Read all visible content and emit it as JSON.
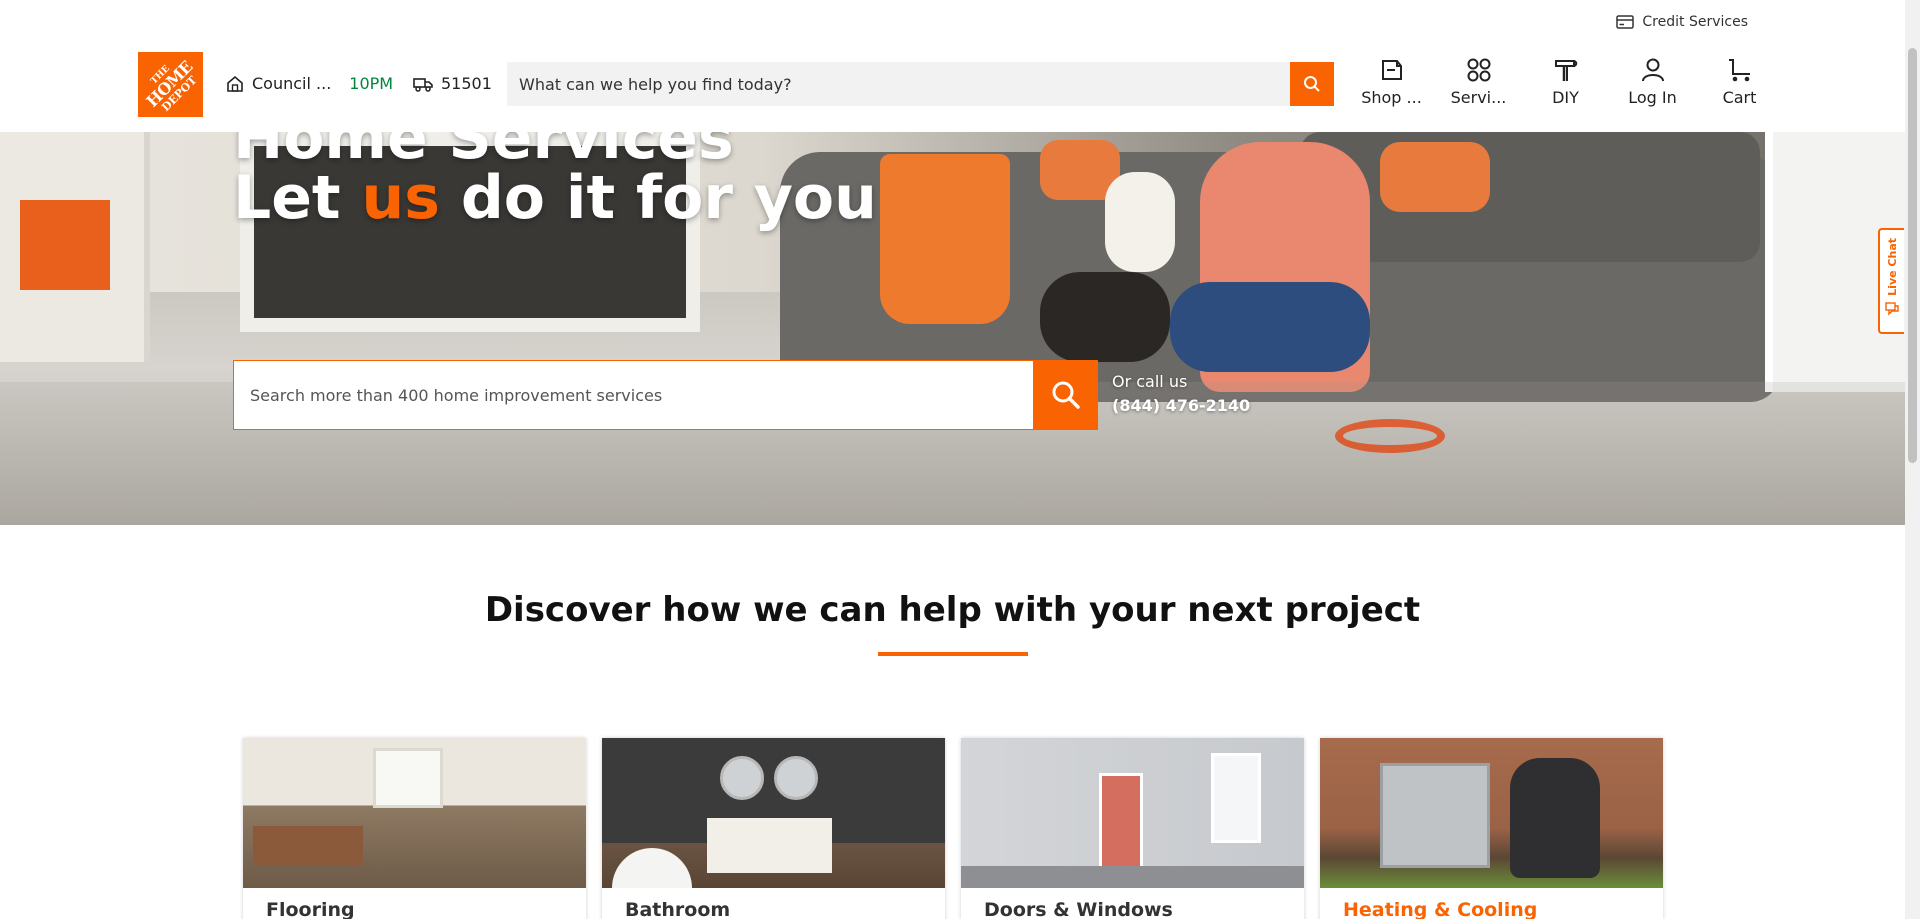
{
  "header": {
    "credit_services": "Credit Services",
    "logo_text": [
      "THE",
      "HOME",
      "DEPOT"
    ],
    "store_name": "Council ...",
    "store_hours": "10PM",
    "delivery_zip": "51501",
    "search_placeholder": "What can we help you find today?",
    "nav": [
      {
        "label": "Shop ...",
        "icon": "shop-icon"
      },
      {
        "label": "Servi...",
        "icon": "services-icon"
      },
      {
        "label": "DIY",
        "icon": "hammer-icon"
      },
      {
        "label": "Log In",
        "icon": "user-icon"
      },
      {
        "label": "Cart",
        "icon": "cart-icon"
      }
    ]
  },
  "hero": {
    "title_line1": "Home Services",
    "title_line2_pre": "Let ",
    "title_line2_accent": "us",
    "title_line2_post": " do it for you",
    "search_placeholder": "Search more than 400 home improvement services",
    "call_label": "Or call us",
    "phone": "(844) 476-2140"
  },
  "live_chat": "Live Chat",
  "discover": {
    "title": "Discover how we can help with your next project"
  },
  "cards": [
    {
      "label": "Flooring"
    },
    {
      "label": "Bathroom"
    },
    {
      "label": "Doors & Windows"
    },
    {
      "label": "Heating & Cooling"
    }
  ],
  "colors": {
    "brand": "#f96302",
    "hours_green": "#00873c"
  }
}
